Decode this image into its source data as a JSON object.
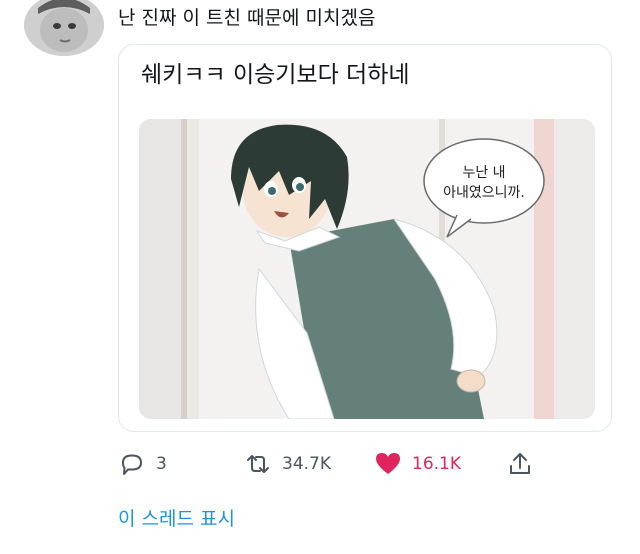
{
  "tweet": {
    "text": "난 진짜 이 트친 때문에 미치겠음",
    "quoted": {
      "text": "쉐키ㅋㅋ 이승기보다 더하네",
      "media": {
        "speech_bubble_line1": "누난 내",
        "speech_bubble_line2": "아내였으니까."
      }
    },
    "actions": {
      "reply_count": "3",
      "retweet_count": "34.7K",
      "like_count": "16.1K",
      "liked": true
    },
    "show_thread_label": "이 스레드 표시"
  },
  "colors": {
    "link": "#1b95e0",
    "like": "#e0245e",
    "icon": "#4a5560",
    "border": "#e1e8ed"
  },
  "icons": [
    "reply-icon",
    "retweet-icon",
    "heart-icon",
    "share-icon"
  ]
}
